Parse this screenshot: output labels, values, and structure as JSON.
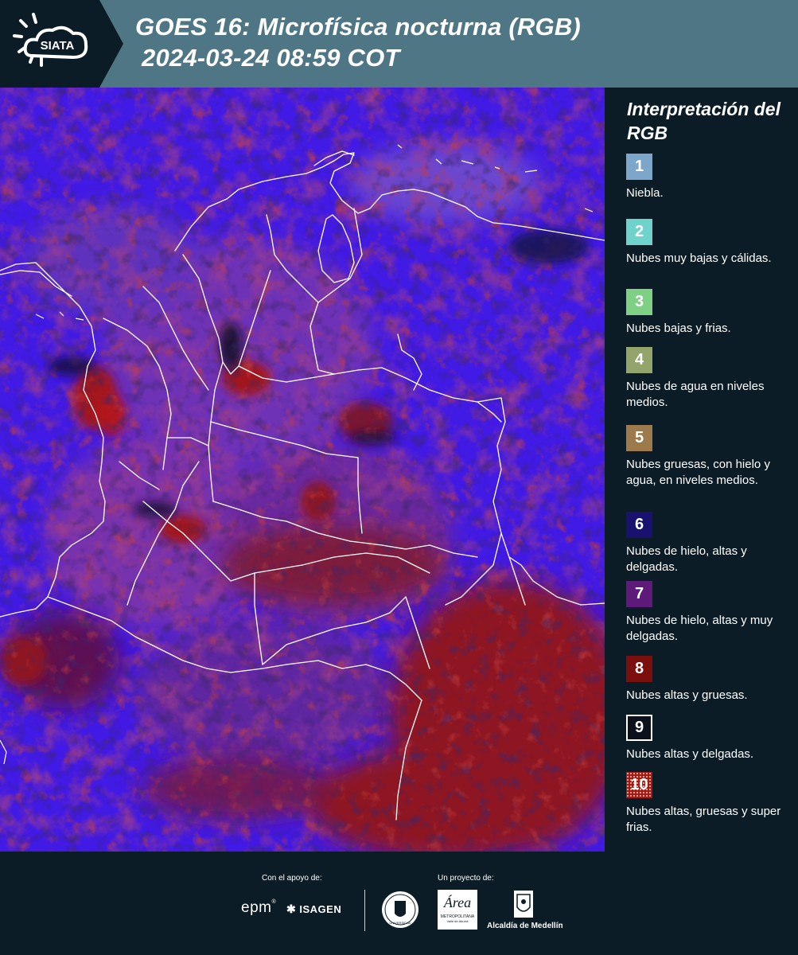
{
  "header": {
    "logo_text": "SIATA",
    "title_line1": "GOES 16: Microfísica nocturna (RGB)",
    "title_line2": "2024-03-24 08:59 COT",
    "background_color": "#4f7684"
  },
  "map": {
    "description_icon": "satellite-rgb-map",
    "border_color": "#ffffff"
  },
  "legend": {
    "title": "Interpretación del RGB",
    "items": [
      {
        "number": "1",
        "label": "Niebla.",
        "color": "#7ca7cb"
      },
      {
        "number": "2",
        "label": "Nubes muy bajas y cálidas.",
        "color": "#70d3cb"
      },
      {
        "number": "3",
        "label": "Nubes bajas y frias.",
        "color": "#7fcf84"
      },
      {
        "number": "4",
        "label": "Nubes de agua en niveles medios.",
        "color": "#93a56a"
      },
      {
        "number": "5",
        "label": "Nubes gruesas, con hielo y agua, en niveles medios.",
        "color": "#9c7a4c"
      },
      {
        "number": "6",
        "label": "Nubes de hielo, altas y delgadas.",
        "color": "#18116e"
      },
      {
        "number": "7",
        "label": "Nubes de hielo, altas y muy delgadas.",
        "color": "#5e1a79"
      },
      {
        "number": "8",
        "label": "Nubes altas y gruesas.",
        "color": "#7a0f0d"
      },
      {
        "number": "9",
        "label": "Nubes altas y delgadas.",
        "color": "#0c0f1c"
      },
      {
        "number": "10",
        "label": "Nubes altas, gruesas y super frias.",
        "color": "#a01a12"
      }
    ]
  },
  "footer": {
    "support_label": "Con el apoyo de:",
    "project_label": "Un proyecto de:",
    "sponsor_1": "epm",
    "sponsor_2": "ISAGEN",
    "partner_area": "Área",
    "partner_area_sub": "METROPOLITANA",
    "partner_area_sub2": "Valle de Aburrá",
    "partner_alcaldia": "Alcaldía de Medellín",
    "partner_university": "UNIVERSIDAD"
  }
}
